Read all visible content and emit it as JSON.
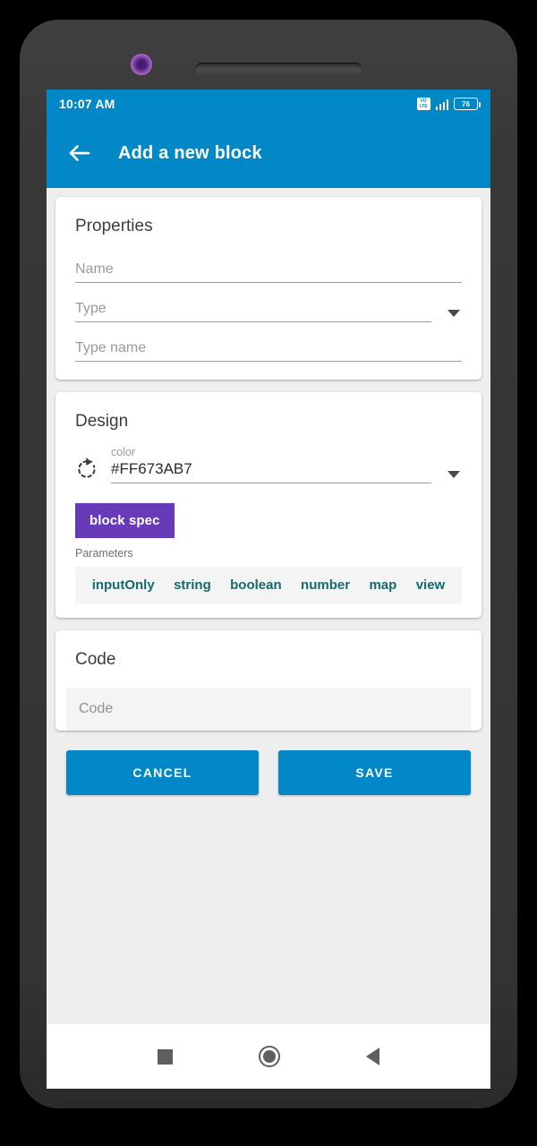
{
  "device": {
    "camera_icon": "camera-dot",
    "speaker_icon": "earpiece-speaker"
  },
  "status_bar": {
    "time": "10:07 AM",
    "volte_top": "VO",
    "volte_bottom": "LTE",
    "battery_level": "76",
    "icons": [
      "volte-icon",
      "signal-icon",
      "battery-icon"
    ]
  },
  "app_bar": {
    "back_icon": "back-arrow-icon",
    "title": "Add a new block"
  },
  "properties": {
    "title": "Properties",
    "name_placeholder": "Name",
    "type_placeholder": "Type",
    "type_name_placeholder": "Type name",
    "dropdown_icon": "chevron-down-icon"
  },
  "design": {
    "title": "Design",
    "refresh_icon": "autorenew-icon",
    "color_label": "color",
    "color_value": "#FF673AB7",
    "color_swatch": "#673AB7",
    "dropdown_icon": "chevron-down-icon",
    "block_spec_label": "block spec",
    "parameters_label": "Parameters",
    "parameters": [
      "inputOnly",
      "string",
      "boolean",
      "number",
      "map",
      "view"
    ],
    "parameter_color": "#136b6b"
  },
  "code": {
    "title": "Code",
    "placeholder": "Code"
  },
  "actions": {
    "cancel_label": "CANCEL",
    "save_label": "SAVE",
    "accent_color": "#0288c7"
  },
  "nav_bar": {
    "recents_icon": "square-recents-icon",
    "home_icon": "circle-home-icon",
    "back_icon": "triangle-back-icon"
  }
}
